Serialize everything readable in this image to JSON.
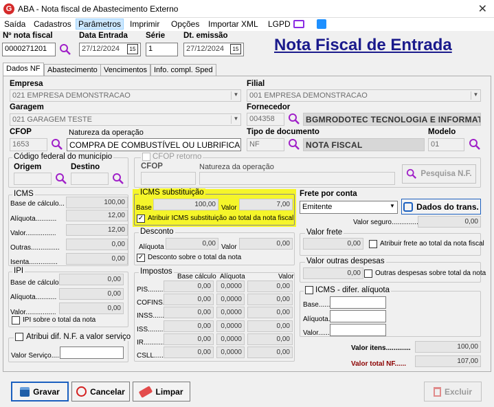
{
  "window": {
    "title": "ABA - Nota fiscal de Abastecimento Externo",
    "close": "✕",
    "app_icon": "G"
  },
  "menu": [
    "Saída",
    "Cadastros",
    "Parâmetros",
    "Imprimir",
    "Opções",
    "Importar XML",
    "LGPD"
  ],
  "header": {
    "nota_label": "Nº nota fiscal",
    "nota_value": "0000271201",
    "data_entrada_label": "Data Entrada",
    "data_entrada_value": "27/12/2024",
    "serie_label": "Série",
    "serie_value": "1",
    "dt_emissao_label": "Dt. emissão",
    "dt_emissao_value": "27/12/2024",
    "page_title": "Nota Fiscal de Entrada",
    "cal_icon": "15"
  },
  "tabs": [
    "Dados NF",
    "Abastecimento",
    "Vencimentos",
    "Info. compl. Sped"
  ],
  "empresa": {
    "label": "Empresa",
    "value": "021 EMPRESA DEMONSTRACAO"
  },
  "filial": {
    "label": "Filial",
    "value": "001 EMPRESA DEMONSTRACAO"
  },
  "garagem": {
    "label": "Garagem",
    "value": "021 GARAGEM TESTE"
  },
  "fornecedor": {
    "label": "Fornecedor",
    "code": "004358",
    "name": "BGMRODOTEC TECNOLOGIA E INFORMATI"
  },
  "cfop": {
    "label": "CFOP",
    "value": "1653",
    "natureza_label": "Natureza da operação",
    "natureza_value": "COMPRA DE COMBUSTÍVEL OU LUBRIFICANTE"
  },
  "tipo_doc": {
    "label": "Tipo de documento",
    "code": "NF",
    "name": "NOTA FISCAL"
  },
  "modelo": {
    "label": "Modelo",
    "value": "01"
  },
  "municipio": {
    "title": "Código federal do município",
    "origem": "Origem",
    "destino": "Destino"
  },
  "cfop_retorno": {
    "title": "CFOP retorno",
    "cfop": "CFOP",
    "natureza": "Natureza da operação",
    "pesquisa": "Pesquisa N.F."
  },
  "icms": {
    "title": "ICMS",
    "rows": [
      {
        "label": "Base de cálculo...",
        "value": "100,00"
      },
      {
        "label": "Alíquota...........",
        "value": "12,00"
      },
      {
        "label": "Valor................",
        "value": "12,00"
      },
      {
        "label": "Outras...............",
        "value": "0,00"
      },
      {
        "label": "Isenta...............",
        "value": "0,00"
      }
    ]
  },
  "icms_st": {
    "title": "ICMS substituição",
    "base_label": "Base",
    "base_value": "100,00",
    "valor_label": "Valor",
    "valor_value": "7,00",
    "check_label": "Atribuir ICMS substituição ao total da nota fiscal",
    "checked": "✓"
  },
  "desconto": {
    "title": "Desconto",
    "aliquota_label": "Alíquota",
    "aliquota_value": "0,00",
    "valor_label": "Valor",
    "valor_value": "0,00",
    "check_label": "Desconto sobre o total da nota",
    "checked": "✓"
  },
  "frete": {
    "title": "Frete por conta",
    "select_value": "Emitente",
    "dados_btn": "Dados do trans.",
    "seguro_label": "Valor seguro...................",
    "seguro_value": "0,00"
  },
  "valor_frete": {
    "title": "Valor frete",
    "value": "0,00",
    "check_label": "Atribuir frete ao total da nota fiscal"
  },
  "outras_despesas": {
    "title": "Valor outras despesas",
    "value": "0,00",
    "check_label": "Outras despesas sobre total da nota"
  },
  "ipi": {
    "title": "IPI",
    "rows": [
      {
        "label": "Base de cálculo...",
        "value": "0,00"
      },
      {
        "label": "Alíquota...........",
        "value": "0,00"
      },
      {
        "label": "Valor................",
        "value": "0,00"
      }
    ],
    "check_label": "IPI sobre o total da nota"
  },
  "impostos": {
    "title": "Impostos",
    "col_base": "Base cálculo",
    "col_aliq": "Alíquota",
    "col_valor": "Valor",
    "rows": [
      {
        "label": "PIS...........",
        "base": "0,00",
        "aliq": "0,0000",
        "valor": "0,00"
      },
      {
        "label": "COFINS.......",
        "base": "0,00",
        "aliq": "0,0000",
        "valor": "0,00"
      },
      {
        "label": "INSS..........",
        "base": "0,00",
        "aliq": "0,0000",
        "valor": "0,00"
      },
      {
        "label": "ISS............",
        "base": "0,00",
        "aliq": "0,0000",
        "valor": "0,00"
      },
      {
        "label": "IR..............",
        "base": "0,00",
        "aliq": "0,0000",
        "valor": "0,00"
      },
      {
        "label": "CSLL...........",
        "base": "0,00",
        "aliq": "0,0000",
        "valor": "0,00"
      }
    ]
  },
  "icms_difer": {
    "title": "ICMS - difer. alíquota",
    "base": "Base.........",
    "aliquota": "Alíquota.......",
    "valor": "Valor........."
  },
  "atribui_servico": {
    "check_label": "Atribui dif. N.F. a valor serviço",
    "valor_label": "Valor Serviço......"
  },
  "totais": {
    "itens_label": "Valor itens.............",
    "itens_value": "100,00",
    "nf_label": "Valor total NF......",
    "nf_value": "107,00"
  },
  "buttons": {
    "gravar": "Gravar",
    "cancelar": "Cancelar",
    "limpar": "Limpar",
    "excluir": "Excluir"
  }
}
